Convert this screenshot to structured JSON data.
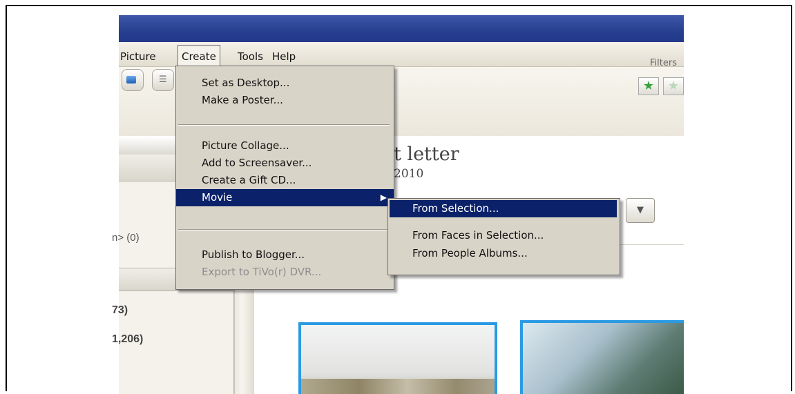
{
  "menubar": {
    "items": [
      "Picture",
      "Create",
      "Tools",
      "Help"
    ]
  },
  "toolbar": {
    "filters_label": "Filters",
    "star_icon": "★"
  },
  "left_panel": {
    "people_item": "n> (0)",
    "count_1": "73)",
    "count_2": "1,206)"
  },
  "album": {
    "title": "t letter",
    "date": "2010"
  },
  "create_menu": {
    "items": [
      "Set as Desktop...",
      "Make a Poster...",
      "Picture Collage...",
      "Add to Screensaver...",
      "Create a Gift CD...",
      "Movie",
      "Publish to Blogger...",
      "Export to TiVo(r) DVR..."
    ]
  },
  "movie_submenu": {
    "items": [
      "From Selection...",
      "From Faces in Selection...",
      "From People Albums..."
    ]
  },
  "colors": {
    "highlight": "#0b2169",
    "titlebar": "#263f8f",
    "thumb_border": "#2a9ae4"
  }
}
